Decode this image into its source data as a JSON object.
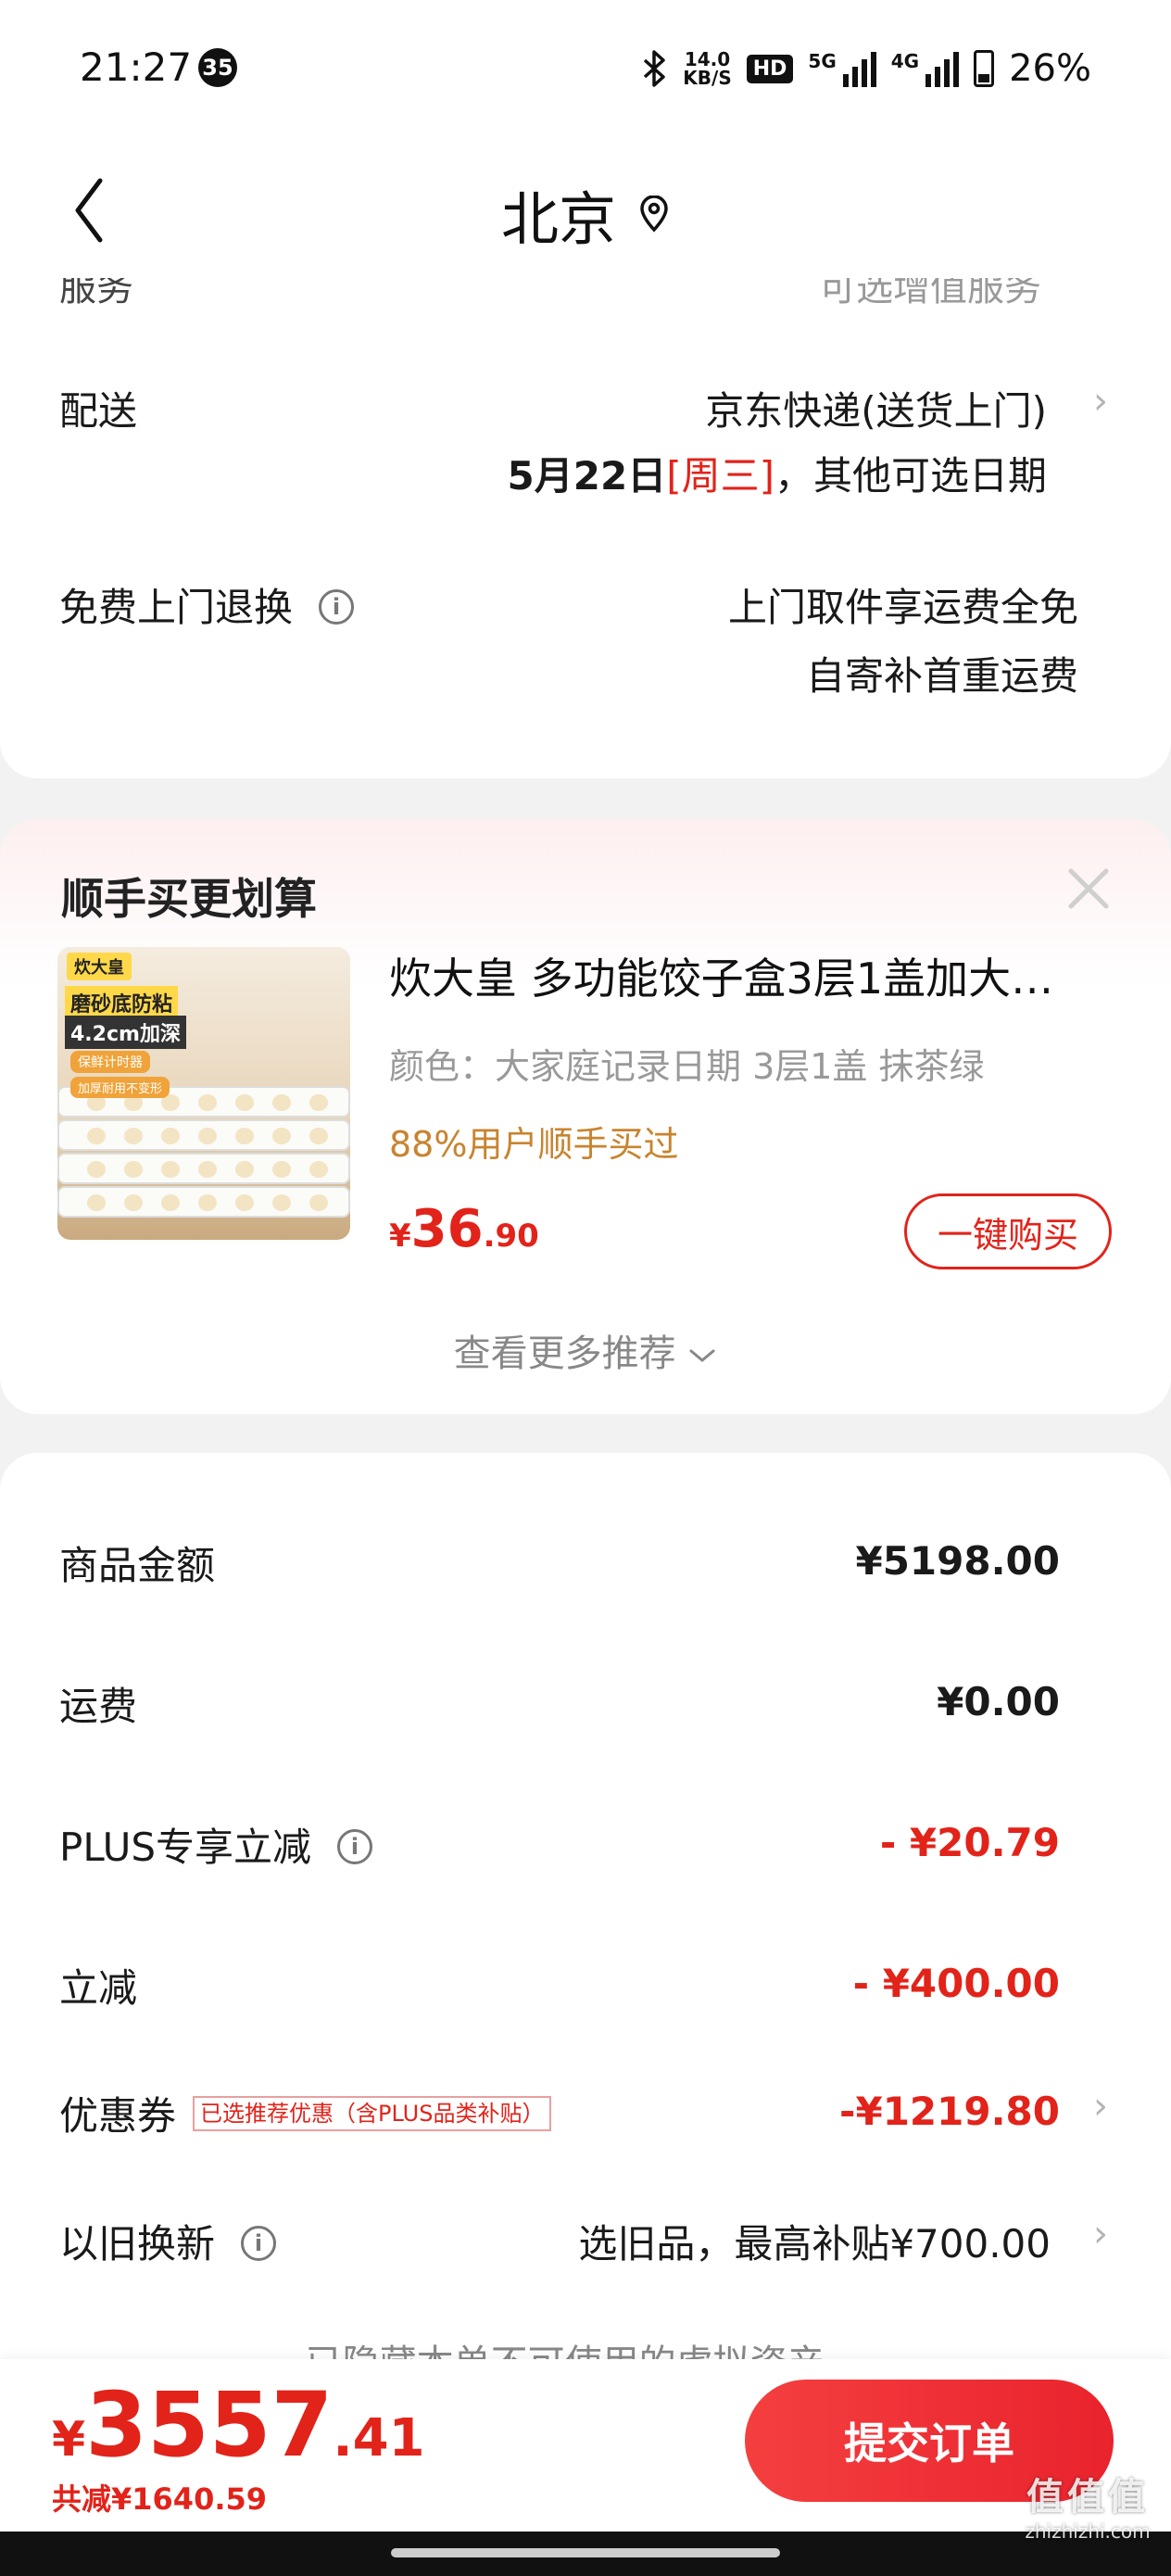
{
  "status_bar": {
    "time": "21:27",
    "notification_count": "35",
    "net_speed_value": "14.0",
    "net_speed_unit": "KB/S",
    "hd_label": "HD",
    "signal1_label": "5G",
    "signal2_label": "4G",
    "battery": "26%"
  },
  "header": {
    "title": "北京"
  },
  "delivery_card": {
    "cut_label": "服务",
    "cut_value": "可选增值服务",
    "shipping_label": "配送",
    "shipping_method": "京东快递(送货上门)",
    "shipping_date": "5月22日",
    "shipping_weekday": "[周三]",
    "shipping_more": "，其他可选日期",
    "return_label": "免费上门退换",
    "return_line1": "上门取件享运费全免",
    "return_line2": "自寄补首重运费"
  },
  "recommend_card": {
    "title": "顺手买更划算",
    "image_brand": "炊大皇",
    "image_line1": "磨砂底防粘",
    "image_line2": "4.2cm加深",
    "image_line3": "保鲜计时器",
    "image_line4": "加厚耐用不变形",
    "product_name": "炊大皇 多功能饺子盒3层1盖加大…",
    "product_spec": "颜色：大家庭记录日期 3层1盖 抹茶绿",
    "product_hint": "88%用户顺手买过",
    "price_symbol": "¥",
    "price_int": "36",
    "price_dec": ".90",
    "buy_label": "一键购买",
    "more_label": "查看更多推荐"
  },
  "price_card": {
    "goods_label": "商品金额",
    "goods_value": "¥5198.00",
    "freight_label": "运费",
    "freight_value": "¥0.00",
    "plus_label": "PLUS专享立减",
    "plus_value": "- ¥20.79",
    "discount_label": "立减",
    "discount_value": "- ¥400.00",
    "coupon_label": "优惠券",
    "coupon_tag": "已选推荐优惠（含PLUS品类补贴）",
    "coupon_value": "-¥1219.80",
    "tradein_label": "以旧换新",
    "tradein_value": "选旧品，最高补贴¥700.00",
    "hidden_note": "已隐藏本单不可使用的虚拟资产"
  },
  "bottom_bar": {
    "total_symbol": "¥",
    "total_int": "3557",
    "total_dec": ".41",
    "saved": "共减¥1640.59",
    "submit_label": "提交订单"
  },
  "watermark": {
    "logo": "值值值",
    "url": "zhizhizhi.com"
  },
  "colors": {
    "accent_red": "#e2231a",
    "hint_orange": "#c8842f",
    "page_bg": "#f2f2f2"
  }
}
